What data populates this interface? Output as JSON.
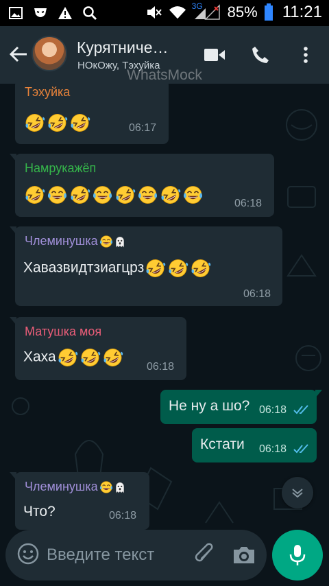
{
  "status_bar": {
    "battery_percent": "85%",
    "time": "11:21",
    "network": "3G",
    "icons": [
      "gallery-icon",
      "mask-icon",
      "warning-icon",
      "search-icon",
      "mute-icon",
      "wifi-icon",
      "signal-icon",
      "battery-icon"
    ]
  },
  "header": {
    "title": "Курятниче…",
    "subtitle": "НОкОжу, Тэхуйка",
    "watermark": "WhatsMock",
    "icons": [
      "back-arrow-icon",
      "video-call-icon",
      "phone-icon",
      "more-options-icon"
    ]
  },
  "messages": [
    {
      "direction": "in",
      "sender": "Тэхуйка",
      "sender_color": "#e8833a",
      "text": "",
      "emojis": [
        "rofl",
        "rofl",
        "rofl"
      ],
      "time": "06:17"
    },
    {
      "direction": "in",
      "sender": "Намрукажёп",
      "sender_color": "#35b54a",
      "text": "",
      "emojis": [
        "rofl",
        "joy",
        "rofl",
        "joy",
        "rofl",
        "joy",
        "rofl",
        "joy"
      ],
      "time": "06:18"
    },
    {
      "direction": "in",
      "sender": "Члеминушка",
      "sender_color": "#a08fd8",
      "sender_emojis": [
        "joy",
        "ghost"
      ],
      "text": "Хавазвидтзиагцрз",
      "emojis": [
        "rofl",
        "rofl",
        "rofl"
      ],
      "time": "06:18"
    },
    {
      "direction": "in",
      "sender": "Матушка моя",
      "sender_color": "#e85d78",
      "text": "Хаха",
      "emojis": [
        "rofl",
        "rofl",
        "rofl"
      ],
      "time": "06:18"
    },
    {
      "direction": "out",
      "text": "Не ну а шо?",
      "time": "06:18",
      "read": true
    },
    {
      "direction": "out",
      "text": "Кстати",
      "time": "06:18",
      "read": true
    },
    {
      "direction": "in",
      "sender": "Члеминушка",
      "sender_color": "#a08fd8",
      "sender_emojis": [
        "joy",
        "ghost"
      ],
      "text": "Что?",
      "emojis": [],
      "time": "06:18"
    }
  ],
  "composer": {
    "placeholder": "Введите текст",
    "icons": [
      "emoji-icon",
      "attach-icon",
      "camera-icon",
      "mic-icon"
    ]
  },
  "colors": {
    "header_bg": "#1f2c34",
    "chat_bg": "#0b141a",
    "incoming_bubble": "#1f2c34",
    "outgoing_bubble": "#005c4b",
    "accent": "#00a884",
    "read_ticks": "#53bdeb"
  }
}
